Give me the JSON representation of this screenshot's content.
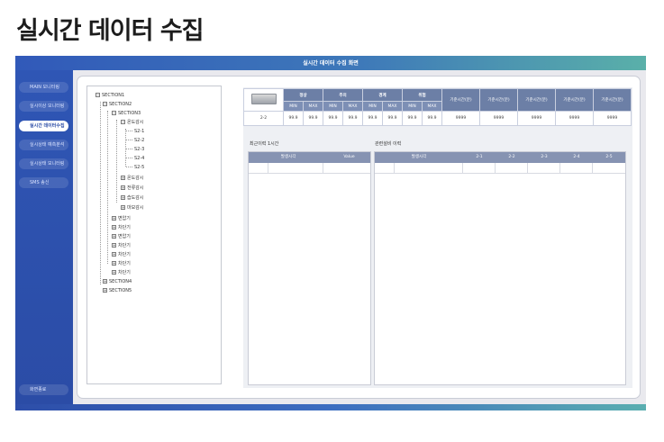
{
  "page_title": "실시간 데이터 수집",
  "app": {
    "title": "실시간 데이터 수집 화면"
  },
  "sidebar": {
    "items": [
      {
        "label": "MAIN 모니터링",
        "active": false
      },
      {
        "label": "실시이상 모니터링",
        "active": false
      },
      {
        "label": "실시간 데이터수집",
        "active": true
      },
      {
        "label": "실시상태 예측분석",
        "active": false
      },
      {
        "label": "실시상태 모니터링",
        "active": false
      },
      {
        "label": "SMS 송신",
        "active": false
      }
    ],
    "logout_label": "화면종료"
  },
  "tree": {
    "nodes": [
      {
        "label": "SECTION1",
        "toggle": "−"
      },
      {
        "label": "SECTION2",
        "toggle": "−"
      },
      {
        "label": "SECTION3",
        "toggle": "−"
      },
      {
        "label": "온도감시",
        "toggle": "−"
      },
      {
        "label": "S2-1",
        "toggle": ""
      },
      {
        "label": "S2-2",
        "toggle": ""
      },
      {
        "label": "S2-3",
        "toggle": ""
      },
      {
        "label": "S2-4",
        "toggle": ""
      },
      {
        "label": "S2-5",
        "toggle": ""
      },
      {
        "label": "온도감시",
        "toggle": "+"
      },
      {
        "label": "전류감시",
        "toggle": "+"
      },
      {
        "label": "습도감시",
        "toggle": "+"
      },
      {
        "label": "마모감시",
        "toggle": "+"
      },
      {
        "label": "변압기",
        "toggle": "+"
      },
      {
        "label": "차단기",
        "toggle": "+"
      },
      {
        "label": "변압기",
        "toggle": "+"
      },
      {
        "label": "차단기",
        "toggle": "+"
      },
      {
        "label": "차단기",
        "toggle": "+"
      },
      {
        "label": "차단기",
        "toggle": "+"
      },
      {
        "label": "차단기",
        "toggle": "+"
      },
      {
        "label": "SECTION4",
        "toggle": "+"
      },
      {
        "label": "SECTION5",
        "toggle": "+"
      }
    ]
  },
  "status_table": {
    "groups": [
      "정상",
      "주의",
      "경계",
      "위험"
    ],
    "min_label": "MIN",
    "max_label": "MAX",
    "ref_headers": [
      "기준시간(분)",
      "기준시간(분)",
      "기준시간(분)",
      "기준시간(분)",
      "기준시간(분)"
    ],
    "row": {
      "name": "2-2",
      "values": [
        "99.9",
        "99.9",
        "99.9",
        "99.9",
        "99.9",
        "99.9",
        "99.9",
        "99.9"
      ],
      "refs": [
        "9999",
        "9999",
        "9999",
        "9999",
        "9999"
      ]
    }
  },
  "recent_history": {
    "title": "최근이력 1시간",
    "columns": [
      "발생시각",
      "Value"
    ]
  },
  "related_history": {
    "title": "관련설비 이력",
    "columns": [
      "발생시각",
      "2-1",
      "2-2",
      "2-3",
      "2-4",
      "2-5"
    ]
  },
  "colors": {
    "sidebar": "#2f56b5",
    "header_gradient_start": "#3159b9",
    "header_gradient_end": "#5ab0a9",
    "table_header": "#6c7fa6"
  }
}
